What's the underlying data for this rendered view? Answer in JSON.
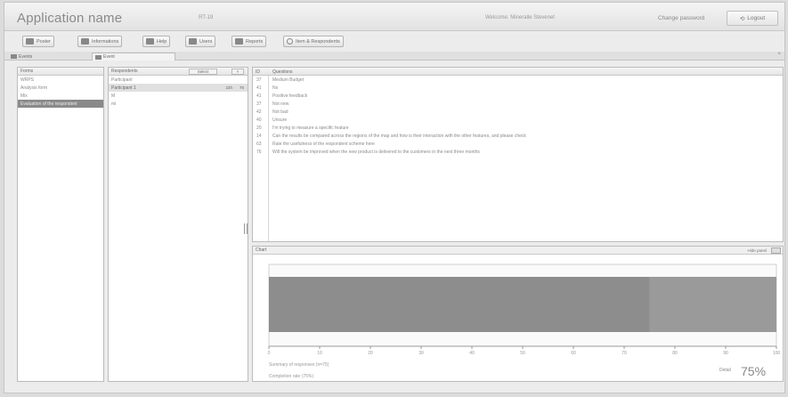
{
  "app": {
    "name": "Application name",
    "code": "RT-19",
    "welcome": "Welcome: Mineralle Stevenet",
    "change_password": "Change password",
    "logout": "Logout"
  },
  "toolbar": [
    {
      "label": "Poster",
      "icon": "grid-icon"
    },
    {
      "label": "Informations",
      "icon": "grid-icon"
    },
    {
      "label": "Help",
      "icon": "grid-icon"
    },
    {
      "label": "Users",
      "icon": "grid-icon"
    },
    {
      "label": "Reports",
      "icon": "grid-icon"
    },
    {
      "label": "Item & Respondents",
      "icon": "search-icon"
    }
  ],
  "tabs": [
    {
      "label": "Events",
      "active": false
    },
    {
      "label": "Event",
      "active": true
    }
  ],
  "tab_close": "×",
  "panel_forms": {
    "header": "Forms",
    "items": [
      "WRPS",
      "Analysis form",
      "Mix",
      "Evaluation of the respondent"
    ],
    "selected": 3
  },
  "panel_respondents": {
    "header": "Respondents",
    "select_label": "Select",
    "clear_label": "×",
    "items": [
      {
        "label": "Participant",
        "cells": []
      },
      {
        "label": "Participant 1",
        "cells": [
          "22h",
          "75"
        ]
      },
      {
        "label": "M",
        "cells": []
      },
      {
        "label": "mi",
        "cells": []
      }
    ],
    "selected": 1
  },
  "panel_questions": {
    "header_id": "ID",
    "header_text": "Questions",
    "rows": [
      {
        "id": "37",
        "text": "Medium Budget"
      },
      {
        "id": "41",
        "text": "No"
      },
      {
        "id": "41",
        "text": "Positive feedback"
      },
      {
        "id": "37",
        "text": "Not new"
      },
      {
        "id": "42",
        "text": "Not bad"
      },
      {
        "id": "40",
        "text": "Unsure"
      },
      {
        "id": "20",
        "text": "I'm trying to measure a specific feature"
      },
      {
        "id": "14",
        "text": "Can the results be compared across the regions of the map and how is their interaction with the other features, and please check"
      },
      {
        "id": "63",
        "text": "Rate the usefulness of the respondent scheme here"
      },
      {
        "id": "76",
        "text": "Will the system be improved when the new product is delivered to the customers in the next three months"
      }
    ]
  },
  "panel_results": {
    "header": "Chart",
    "hide_label": "Hide panel",
    "results_caption": "Summary of responses (n=75)",
    "completion": "Completion rate (75%)",
    "detail_label": "Detail",
    "percent": "75%"
  },
  "chart_data": {
    "type": "bar",
    "orientation": "horizontal",
    "categories": [
      ""
    ],
    "values": [
      75
    ],
    "xlim": [
      0,
      100
    ],
    "x_ticks": [
      "0",
      "10",
      "20",
      "30",
      "40",
      "50",
      "60",
      "70",
      "80",
      "90",
      "100"
    ],
    "grid": false,
    "bar_color": "#8d8d8d"
  },
  "colors": {
    "selected_row": "#8a8a8a",
    "panel_border": "#bcbcbc"
  }
}
